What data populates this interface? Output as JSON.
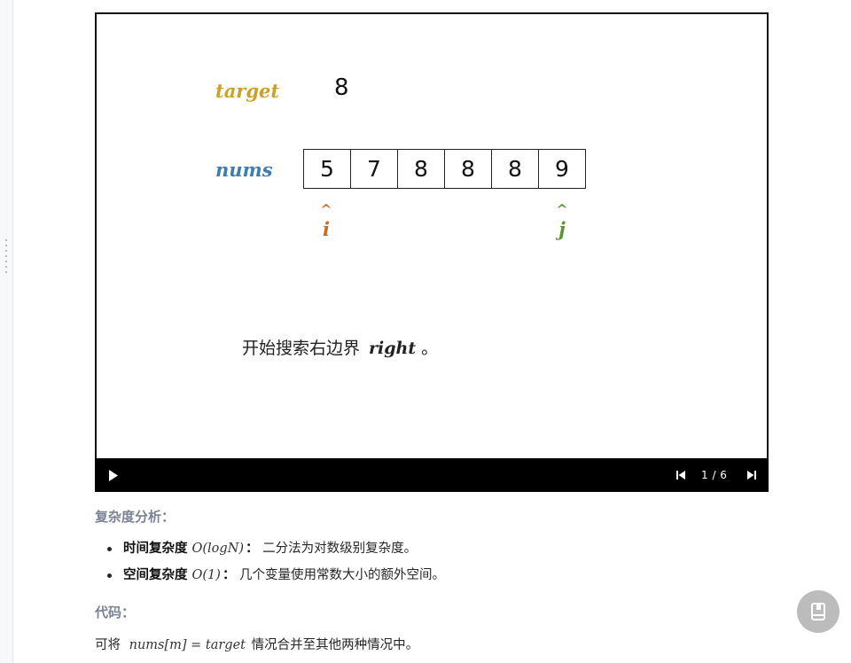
{
  "slide": {
    "target_label": "target",
    "target_value": "8",
    "nums_label": "nums",
    "nums": [
      "5",
      "7",
      "8",
      "8",
      "8",
      "9"
    ],
    "pointer_i": {
      "caret": "^",
      "name": "i"
    },
    "pointer_j": {
      "caret": "^",
      "name": "j"
    },
    "caption_prefix": "开始搜索右边界",
    "caption_keyword": "right",
    "caption_suffix": "。"
  },
  "player": {
    "counter": "1 / 6",
    "icons": {
      "play": "play-icon",
      "prev": "skip-previous-icon",
      "next": "skip-next-icon"
    }
  },
  "analysis": {
    "heading": "复杂度分析：",
    "items": [
      {
        "label": "时间复杂度",
        "math": "O(logN)",
        "colon": "：",
        "text": "二分法为对数级别复杂度。"
      },
      {
        "label": "空间复杂度",
        "math": "O(1)",
        "colon": "：",
        "text": "几个变量使用常数大小的额外空间。"
      }
    ]
  },
  "code": {
    "heading": "代码：",
    "para_prefix": "可将",
    "para_math": "nums[m] = target",
    "para_suffix": "情况合并至其他两种情况中。"
  },
  "colors": {
    "target": "#c9a227",
    "nums": "#3e7cb1",
    "pointer_i": "#c76b2b",
    "pointer_j": "#5d9436",
    "heading": "#7a8394"
  },
  "fab": {
    "icon": "notebook-icon"
  }
}
